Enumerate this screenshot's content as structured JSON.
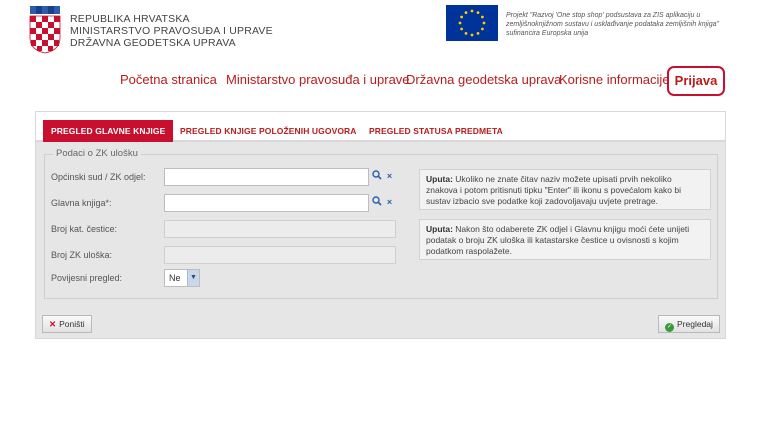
{
  "header": {
    "ministry_lines": [
      "REPUBLIKA HRVATSKA",
      "MINISTARSTVO PRAVOSUĐA I UPRAVE",
      "DRŽAVNA GEODETSKA UPRAVA"
    ],
    "eu_project_text": "Projekt \"Razvoj 'One stop shop' podsustava za ZIS aplikaciju u zemljišnoknjižnom sustavu i usklađivanje podataka zemljišnih knjiga\" sufinancira Europska unija"
  },
  "nav": {
    "items": [
      "Početna stranica",
      "Ministarstvo pravosuđa i uprave",
      "Državna geodetska uprava",
      "Korisne informacije"
    ],
    "login": "Prijava"
  },
  "tabs": [
    "PREGLED GLAVNE KNJIGE",
    "PREGLED KNJIGE POLOŽENIH UGOVORA",
    "PREGLED STATUSA PREDMETA"
  ],
  "form": {
    "legend": "Podaci o ZK ulošku",
    "fields": {
      "court_label": "Općinski sud / ZK odjel:",
      "book_label": "Glavna knjiga*:",
      "parcel_label": "Broj kat. čestice:",
      "entry_label": "Broj ZK uloška:",
      "history_label": "Povijesni pregled:",
      "history_value": "Ne"
    },
    "hint1_title": "Uputa:",
    "hint1_text": "Ukoliko ne znate čitav naziv možete upisati prvih nekoliko znakova i potom pritisnuti tipku \"Enter\" ili ikonu s povećalom kako bi sustav izbacio sve podatke koji zadovoljavaju uvjete pretrage.",
    "hint2_title": "Uputa:",
    "hint2_text": "Nakon što odaberete ZK odjel i Glavnu knjigu moći ćete unijeti podatak o broju ZK uloška ili katastarske čestice u ovisnosti s kojim podatkom raspolažete."
  },
  "buttons": {
    "reset": "Poništi",
    "view": "Pregledaj"
  },
  "colors": {
    "brand_red": "#c8102e",
    "eu_blue": "#003399",
    "eu_star": "#ffcc00"
  }
}
